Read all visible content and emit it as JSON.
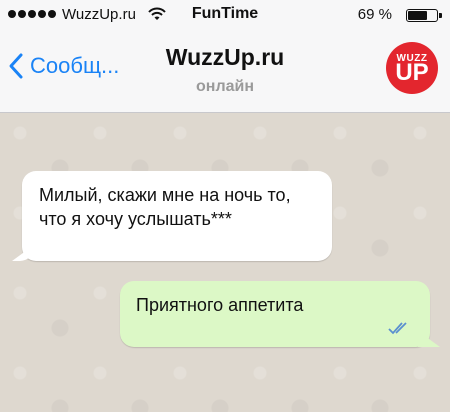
{
  "status_bar": {
    "carrier": "WuzzUp.ru",
    "time": "FunTime",
    "battery_percent_label": "69 %",
    "battery_level": 0.69
  },
  "nav_bar": {
    "back_label": "Сообщ...",
    "title": "WuzzUp.ru",
    "subtitle": "онлайн",
    "avatar_top": "WUZZ",
    "avatar_bottom": "UP",
    "accent_color": "#1a83f6",
    "avatar_color": "#e3262e"
  },
  "messages": [
    {
      "direction": "incoming",
      "text": "Милый, скажи мне на ночь то, что я хочу услышать***"
    },
    {
      "direction": "outgoing",
      "text": "Приятного аппетита",
      "status_icon": "double-check-icon"
    }
  ]
}
